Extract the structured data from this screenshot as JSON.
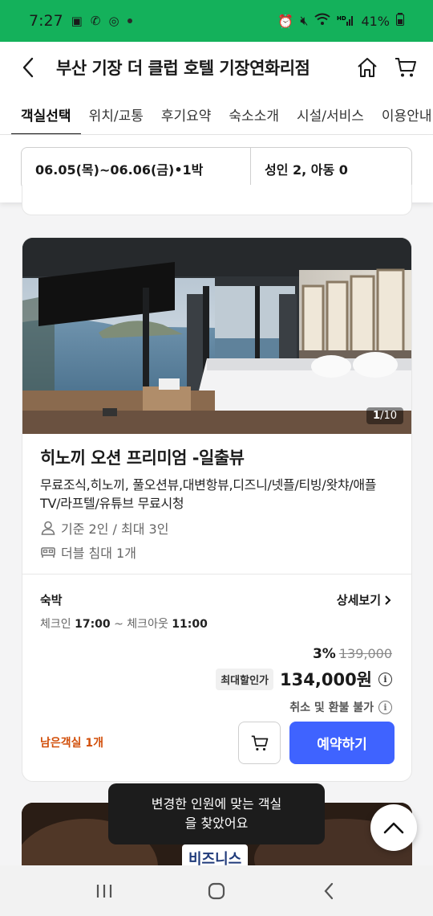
{
  "status": {
    "time": "7:27",
    "battery": "41%",
    "colors": {
      "bar": "#14b15b"
    }
  },
  "header": {
    "title": "부산 기장 더 클럽 호텔 기장연화리점",
    "icons": [
      "back-icon",
      "home-icon",
      "cart-icon"
    ]
  },
  "tabs": [
    {
      "label": "객실선택",
      "active": true
    },
    {
      "label": "위치/교통"
    },
    {
      "label": "후기요약"
    },
    {
      "label": "숙소소개"
    },
    {
      "label": "시설/서비스"
    },
    {
      "label": "이용안내"
    }
  ],
  "search": {
    "dates": "06.05(목)~06.06(금)•1박",
    "guests": "성인 2, 아동 0"
  },
  "room": {
    "photo_counter_current": "1",
    "photo_counter_total": "/10",
    "name": "히노끼 오션 프리미엄 -일출뷰",
    "description": "무료조식,히노끼, 풀오션뷰,대변항뷰,디즈니/넷플/티빙/왓챠/애플TV/라프텔/유튜브 무료시청",
    "capacity": "기준 2인 / 최대 3인",
    "bed": "더블 침대 1개",
    "stay_type": "숙박",
    "detail_link": "상세보기",
    "checkin_label": "체크인",
    "checkin_time": "17:00",
    "checkout_label": "~ 체크아웃",
    "checkout_time": "11:00",
    "discount": "3%",
    "original_price": "139,000",
    "max_discount_badge": "최대할인가",
    "final_price": "134,000원",
    "refund": "취소 및 환불 불가",
    "rooms_left": "남은객실 1개",
    "reserve_label": "예약하기",
    "accent_color": "#3f63ff",
    "warning_color": "#d24f0a"
  },
  "next_room": {
    "label": "비즈니스"
  },
  "toast": {
    "line1": "변경한 인원에 맞는 객실",
    "line2": "을 찾았어요"
  },
  "nav": {
    "icons": [
      "recent-apps-icon",
      "home-circle-icon",
      "back-chevron-icon"
    ]
  }
}
